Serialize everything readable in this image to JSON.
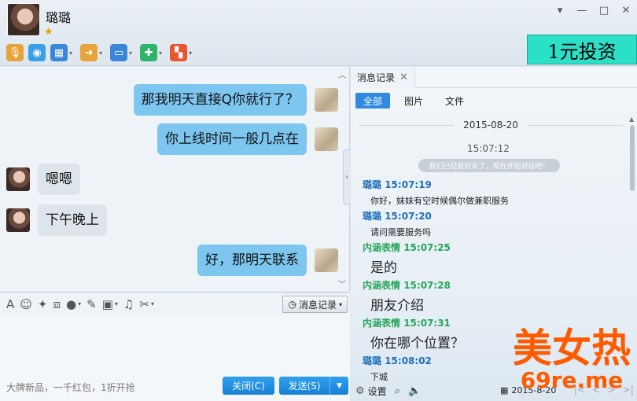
{
  "window": {
    "contact_name": "璐璐",
    "controls": [
      "▾",
      "—",
      "□",
      "✕"
    ]
  },
  "toolbar": {
    "items": [
      {
        "name": "voice-call",
        "color": "#e8a23a",
        "glyph": "🎙"
      },
      {
        "name": "video-call",
        "color": "#3a9ee8",
        "glyph": "◉"
      },
      {
        "name": "remote-desktop",
        "color": "#3a87d8",
        "glyph": "▦"
      },
      {
        "name": "send-file",
        "color": "#e8a23a",
        "glyph": "➜"
      },
      {
        "name": "screen-share",
        "color": "#3a87d8",
        "glyph": "▭"
      },
      {
        "name": "create-group",
        "color": "#2db36a",
        "glyph": "✚"
      },
      {
        "name": "app-center",
        "color": "#e8552f",
        "glyph": "▚"
      }
    ]
  },
  "ad": {
    "text": "1元投资"
  },
  "chat": {
    "messages": [
      {
        "from": "me",
        "text": "那我明天直接Q你就行了？"
      },
      {
        "from": "me",
        "text": "你上线时间一般几点在"
      },
      {
        "from": "her",
        "text": "嗯嗯"
      },
      {
        "from": "her",
        "text": "下午晚上"
      },
      {
        "from": "me",
        "text": "好，那明天联系"
      }
    ]
  },
  "input": {
    "history_button": "消息记录",
    "footer_promo": "大牌新品，一千红包，1折开抢",
    "close_button": "关闭(C)",
    "send_button": "发送(S)"
  },
  "history": {
    "tab_title": "消息记录",
    "filters": [
      "全部",
      "图片",
      "文件"
    ],
    "date": "2015-08-20",
    "time": "15:07:12",
    "system_message": "我们已经是好友了，现在开始对话吧！",
    "entries": [
      {
        "sender": "璐璐",
        "time": "15:07:19",
        "who": "her",
        "text": "你好，妹妹有空时候偶尔做兼职服务",
        "big": false
      },
      {
        "sender": "璐璐",
        "time": "15:07:20",
        "who": "her",
        "text": "请问需要服务吗",
        "big": false
      },
      {
        "sender": "内涵表情",
        "time": "15:07:25",
        "who": "me",
        "text": "是的",
        "big": true
      },
      {
        "sender": "内涵表情",
        "time": "15:07:28",
        "who": "me",
        "text": "朋友介绍",
        "big": true
      },
      {
        "sender": "内涵表情",
        "time": "15:07:31",
        "who": "me",
        "text": "你在哪个位置？",
        "big": true
      },
      {
        "sender": "璐璐",
        "time": "15:08:02",
        "who": "her",
        "text": "下城",
        "big": false
      }
    ],
    "settings_label": "设置",
    "date_field": "2015-8-20"
  },
  "watermark": {
    "line1": "美女热",
    "line2": "69re.me"
  }
}
